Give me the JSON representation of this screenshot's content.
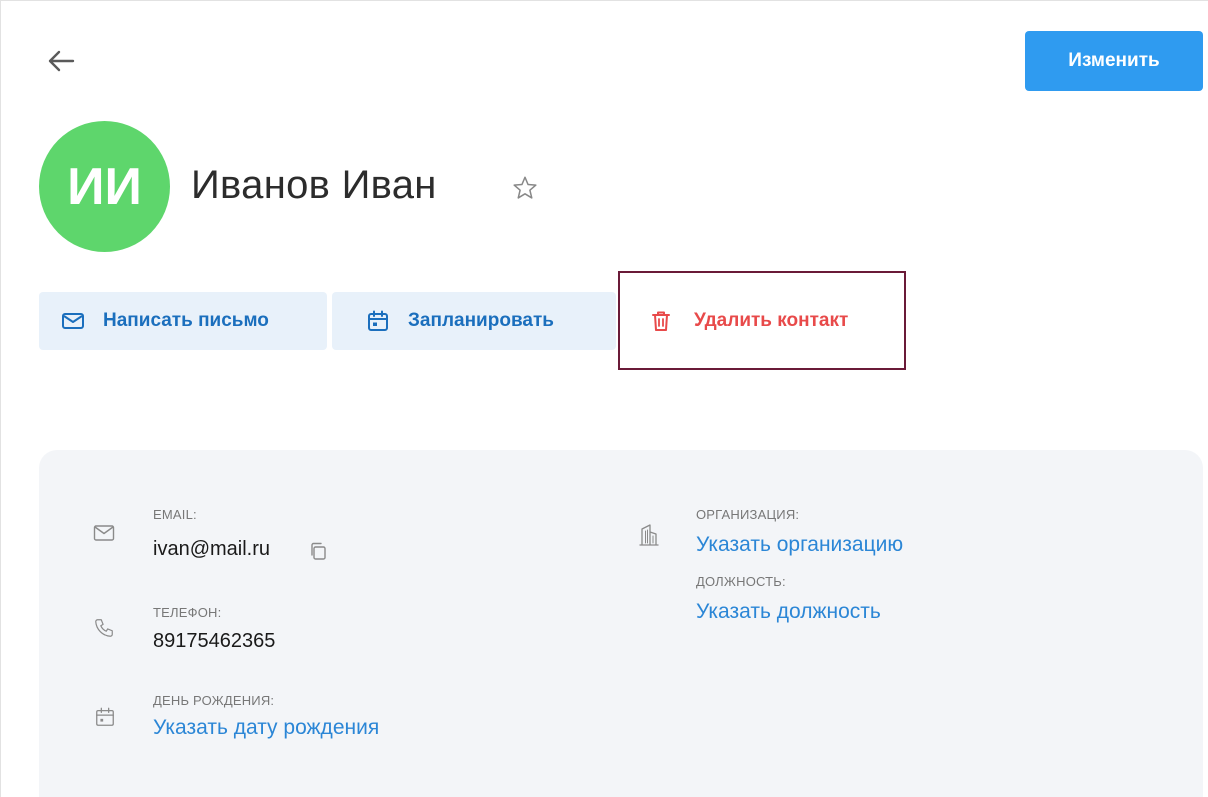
{
  "header": {
    "back_icon": "arrow-left-icon",
    "edit_label": "Изменить"
  },
  "contact": {
    "initials": "ИИ",
    "name": "Иванов Иван",
    "avatar_color": "#5ed66c",
    "favorite_icon": "star-outline-icon"
  },
  "actions": {
    "write_label": "Написать письмо",
    "plan_label": "Запланировать",
    "delete_label": "Удалить контакт"
  },
  "details": {
    "email_label": "EMAIL:",
    "email_value": "ivan@mail.ru",
    "phone_label": "ТЕЛЕФОН:",
    "phone_value": "89175462365",
    "birthday_label": "ДЕНЬ РОЖДЕНИЯ:",
    "birthday_link": "Указать дату рождения",
    "org_label": "ОРГАНИЗАЦИЯ:",
    "org_link": "Указать организацию",
    "position_label": "ДОЛЖНОСТЬ:",
    "position_link": "Указать должность"
  },
  "colors": {
    "accent": "#2f9bf0",
    "link": "#2b86d6",
    "danger": "#e84a4a",
    "highlight_border": "#6a1a38"
  }
}
